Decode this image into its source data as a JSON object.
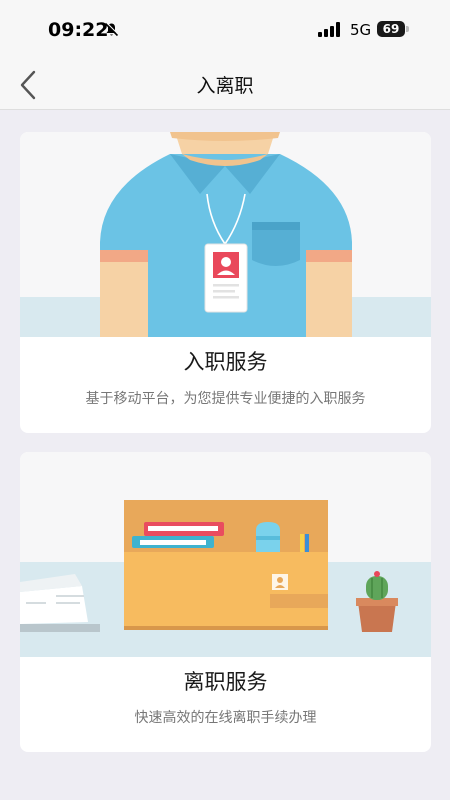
{
  "status_bar": {
    "time": "09:22",
    "network": "5G",
    "battery": "69",
    "bell_icon": "bell-slash-icon",
    "signal_icon": "cellular-signal-icon"
  },
  "nav": {
    "title": "入离职",
    "back_icon": "chevron-left-icon"
  },
  "cards": [
    {
      "title": "入职服务",
      "description": "基于移动平台，为您提供专业便捷的入职服务",
      "illustration": "employee-badge-illustration"
    },
    {
      "title": "离职服务",
      "description": "快速高效的在线离职手续办理",
      "illustration": "desk-box-illustration"
    }
  ],
  "colors": {
    "page_bg": "#eeedf3",
    "card_bg": "#ffffff",
    "shirt": "#6bc3e5",
    "box": "#f7bb5f"
  }
}
